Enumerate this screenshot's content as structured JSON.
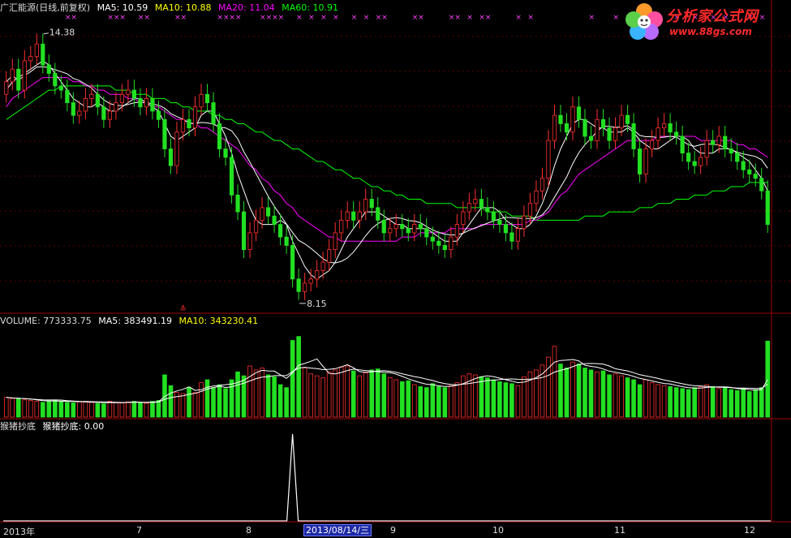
{
  "header": {
    "title": "广汇能源(日线,前复权)",
    "ma5": "MA5: 10.59",
    "ma10": "MA10: 10.88",
    "ma20": "MA20: 11.04",
    "ma60": "MA60: 10.91"
  },
  "volume_header": {
    "volume": "VOLUME: 773333.75",
    "ma5": "MA5: 383491.19",
    "ma10": "MA10: 343230.41"
  },
  "indicator_header": {
    "name": "猴猪抄底",
    "value": "猴猪抄底: 0.00"
  },
  "logo": {
    "title": "分析家公式网",
    "url": "www.88gs.com"
  },
  "x_axis": {
    "ticks": [
      "2013年",
      "7",
      "8",
      "9",
      "10",
      "11",
      "12"
    ],
    "cursor_date": "2013/08/14/三"
  },
  "colors": {
    "up": "#ff3030",
    "down": "#22e022",
    "ma5": "#ffffff",
    "ma10": "#ffff00",
    "ma20": "#ff00ff",
    "ma60": "#00ff00",
    "separator": "#a00000"
  },
  "chart_data": [
    {
      "type": "candlestick",
      "title": "广汇能源(日线,前复权)",
      "series": [
        {
          "name": "MA5",
          "value": 10.59
        },
        {
          "name": "MA10",
          "value": 10.88
        },
        {
          "name": "MA20",
          "value": 11.04
        },
        {
          "name": "MA60",
          "value": 10.91
        }
      ],
      "annotations": [
        {
          "text": "14.38",
          "kind": "high"
        },
        {
          "text": "8.15",
          "kind": "low"
        }
      ],
      "ylim": [
        7.8,
        14.8
      ],
      "close": [
        13.2,
        13.5,
        13.0,
        13.7,
        13.8,
        14.1,
        13.6,
        13.4,
        13.1,
        13.0,
        12.7,
        12.4,
        12.5,
        12.8,
        12.9,
        12.6,
        12.3,
        12.5,
        12.7,
        12.9,
        13.0,
        12.8,
        12.6,
        12.8,
        12.5,
        12.3,
        11.6,
        11.2,
        12.0,
        12.3,
        12.1,
        12.6,
        12.9,
        12.7,
        12.2,
        11.6,
        11.4,
        10.5,
        10.1,
        9.2,
        9.6,
        9.9,
        10.2,
        10.0,
        9.8,
        9.5,
        9.3,
        8.5,
        8.2,
        8.4,
        8.5,
        8.7,
        8.9,
        9.2,
        9.6,
        9.9,
        10.1,
        9.9,
        10.1,
        10.4,
        10.2,
        9.9,
        9.6,
        9.7,
        9.8,
        9.7,
        9.6,
        9.8,
        9.7,
        9.5,
        9.4,
        9.3,
        9.2,
        9.5,
        9.8,
        10.1,
        10.3,
        10.4,
        10.2,
        10.1,
        9.9,
        9.8,
        9.6,
        9.4,
        9.7,
        10.0,
        10.3,
        10.6,
        10.9,
        11.8,
        12.4,
        12.2,
        12.0,
        12.6,
        12.3,
        11.9,
        11.8,
        12.3,
        12.1,
        11.8,
        12.1,
        12.4,
        12.2,
        11.6,
        11.0,
        11.6,
        11.8,
        12.1,
        12.2,
        12.0,
        11.9,
        11.5,
        11.3,
        11.2,
        11.4,
        11.8,
        11.7,
        11.9,
        11.6,
        11.5,
        11.3,
        11.1,
        11.0,
        10.9,
        10.6,
        9.8
      ],
      "open": [
        12.9,
        13.2,
        13.5,
        13.0,
        13.7,
        13.8,
        14.1,
        13.6,
        13.4,
        13.1,
        13.0,
        12.7,
        12.4,
        12.5,
        12.8,
        12.9,
        12.6,
        12.3,
        12.5,
        12.7,
        12.9,
        13.0,
        12.8,
        12.6,
        12.8,
        12.5,
        12.3,
        11.6,
        11.2,
        12.0,
        12.3,
        12.1,
        12.6,
        12.9,
        12.7,
        12.2,
        11.6,
        11.4,
        10.5,
        10.1,
        9.2,
        9.6,
        9.9,
        10.2,
        10.0,
        9.8,
        9.5,
        9.3,
        8.5,
        8.2,
        8.4,
        8.5,
        8.7,
        8.9,
        9.2,
        9.6,
        9.9,
        10.1,
        9.9,
        10.1,
        10.4,
        10.2,
        9.9,
        9.6,
        9.7,
        9.8,
        9.7,
        9.6,
        9.8,
        9.7,
        9.5,
        9.4,
        9.3,
        9.2,
        9.5,
        9.8,
        10.1,
        10.3,
        10.4,
        10.2,
        10.1,
        9.9,
        9.8,
        9.6,
        9.4,
        9.7,
        10.0,
        10.3,
        10.6,
        10.9,
        11.8,
        12.4,
        12.2,
        12.0,
        12.6,
        12.3,
        11.9,
        11.8,
        12.3,
        12.1,
        11.8,
        12.1,
        12.4,
        12.2,
        11.6,
        11.0,
        11.6,
        11.8,
        12.1,
        12.2,
        12.0,
        11.9,
        11.5,
        11.3,
        11.2,
        11.4,
        11.8,
        11.7,
        11.9,
        11.6,
        11.5,
        11.3,
        11.1,
        11.0,
        10.9,
        10.6
      ],
      "ma5": [
        13.0,
        13.2,
        13.3,
        13.4,
        13.5,
        13.6,
        13.7,
        13.6,
        13.4,
        13.2,
        13.0,
        12.8,
        12.7,
        12.6,
        12.6,
        12.7,
        12.6,
        12.5,
        12.5,
        12.6,
        12.7,
        12.8,
        12.8,
        12.7,
        12.6,
        12.5,
        12.2,
        11.9,
        11.8,
        11.9,
        12.0,
        12.1,
        12.4,
        12.5,
        12.5,
        12.2,
        11.9,
        11.5,
        11.0,
        10.6,
        10.2,
        9.9,
        9.8,
        9.8,
        9.8,
        9.9,
        9.8,
        9.4,
        9.1,
        8.8,
        8.6,
        8.5,
        8.6,
        8.7,
        8.9,
        9.2,
        9.5,
        9.7,
        9.9,
        10.1,
        10.1,
        10.1,
        10.0,
        9.9,
        9.8,
        9.8,
        9.7,
        9.7,
        9.7,
        9.7,
        9.6,
        9.5,
        9.4,
        9.4,
        9.4,
        9.6,
        9.8,
        10.0,
        10.2,
        10.2,
        10.2,
        10.1,
        9.9,
        9.8,
        9.7,
        9.7,
        9.8,
        10.0,
        10.3,
        10.7,
        11.2,
        11.6,
        11.9,
        12.2,
        12.3,
        12.3,
        12.2,
        12.1,
        12.1,
        12.0,
        12.0,
        12.0,
        12.1,
        12.0,
        11.8,
        11.7,
        11.6,
        11.6,
        11.7,
        11.8,
        11.9,
        11.9,
        11.8,
        11.6,
        11.5,
        11.5,
        11.5,
        11.6,
        11.6,
        11.6,
        11.5,
        11.4,
        11.3,
        11.1,
        10.9,
        10.6
      ],
      "ma20": [
        12.6,
        12.8,
        12.9,
        13.0,
        13.1,
        13.2,
        13.3,
        13.3,
        13.3,
        13.3,
        13.3,
        13.2,
        13.2,
        13.1,
        13.1,
        13.0,
        13.0,
        12.9,
        12.9,
        12.9,
        12.8,
        12.8,
        12.7,
        12.7,
        12.6,
        12.6,
        12.5,
        12.4,
        12.3,
        12.3,
        12.2,
        12.2,
        12.1,
        12.1,
        12.0,
        11.9,
        11.8,
        11.7,
        11.6,
        11.4,
        11.2,
        11.1,
        10.9,
        10.8,
        10.6,
        10.5,
        10.3,
        10.2,
        10.0,
        9.9,
        9.8,
        9.7,
        9.6,
        9.5,
        9.5,
        9.4,
        9.4,
        9.4,
        9.4,
        9.4,
        9.4,
        9.4,
        9.4,
        9.4,
        9.4,
        9.5,
        9.5,
        9.5,
        9.6,
        9.6,
        9.6,
        9.6,
        9.6,
        9.7,
        9.7,
        9.7,
        9.7,
        9.7,
        9.8,
        9.8,
        9.8,
        9.8,
        9.8,
        9.8,
        9.8,
        9.8,
        9.9,
        9.9,
        10.0,
        10.1,
        10.3,
        10.5,
        10.6,
        10.8,
        11.0,
        11.1,
        11.2,
        11.3,
        11.4,
        11.5,
        11.6,
        11.7,
        11.8,
        11.8,
        11.8,
        11.8,
        11.8,
        11.9,
        11.9,
        11.9,
        11.9,
        11.9,
        11.9,
        11.9,
        11.8,
        11.8,
        11.8,
        11.8,
        11.8,
        11.8,
        11.7,
        11.7,
        11.6,
        11.6,
        11.5,
        11.4
      ],
      "ma60": [
        12.3,
        12.4,
        12.5,
        12.6,
        12.7,
        12.8,
        12.9,
        13.0,
        13.0,
        13.1,
        13.1,
        13.1,
        13.1,
        13.1,
        13.1,
        13.1,
        13.1,
        13.1,
        13.0,
        13.0,
        13.0,
        12.9,
        12.9,
        12.9,
        12.8,
        12.8,
        12.8,
        12.7,
        12.7,
        12.6,
        12.6,
        12.5,
        12.5,
        12.5,
        12.4,
        12.4,
        12.3,
        12.3,
        12.2,
        12.2,
        12.1,
        12.0,
        12.0,
        11.9,
        11.8,
        11.8,
        11.7,
        11.6,
        11.6,
        11.5,
        11.4,
        11.3,
        11.3,
        11.2,
        11.1,
        11.1,
        11.0,
        10.9,
        10.9,
        10.8,
        10.7,
        10.7,
        10.6,
        10.6,
        10.5,
        10.5,
        10.4,
        10.4,
        10.4,
        10.3,
        10.3,
        10.3,
        10.3,
        10.3,
        10.2,
        10.2,
        10.2,
        10.2,
        10.2,
        10.1,
        10.1,
        10.1,
        10.1,
        10.0,
        10.0,
        10.0,
        10.0,
        9.9,
        9.9,
        9.9,
        9.9,
        9.9,
        9.9,
        9.9,
        9.9,
        10.0,
        10.0,
        10.0,
        10.0,
        10.1,
        10.1,
        10.1,
        10.1,
        10.1,
        10.2,
        10.2,
        10.2,
        10.3,
        10.3,
        10.3,
        10.4,
        10.4,
        10.4,
        10.5,
        10.5,
        10.5,
        10.6,
        10.6,
        10.6,
        10.7,
        10.7,
        10.7,
        10.8,
        10.8,
        10.8,
        10.8
      ]
    },
    {
      "type": "bar",
      "title": "VOLUME: 773333.75",
      "series": [
        {
          "name": "VOLUME",
          "value": 773333.75
        },
        {
          "name": "MA5",
          "value": 383491.19
        },
        {
          "name": "MA10",
          "value": 343230.41
        }
      ],
      "ylim": [
        0,
        900000
      ],
      "values": [
        200000,
        190000,
        185000,
        175000,
        170000,
        160000,
        150000,
        165000,
        175000,
        160000,
        150000,
        145000,
        155000,
        160000,
        150000,
        140000,
        135000,
        160000,
        150000,
        145000,
        155000,
        160000,
        150000,
        140000,
        160000,
        170000,
        430000,
        320000,
        250000,
        240000,
        300000,
        250000,
        350000,
        380000,
        300000,
        330000,
        290000,
        380000,
        460000,
        420000,
        520000,
        480000,
        500000,
        430000,
        410000,
        330000,
        300000,
        780000,
        820000,
        500000,
        440000,
        420000,
        400000,
        460000,
        480000,
        510000,
        520000,
        470000,
        420000,
        450000,
        480000,
        490000,
        440000,
        400000,
        380000,
        360000,
        370000,
        330000,
        310000,
        300000,
        340000,
        310000,
        300000,
        320000,
        350000,
        420000,
        440000,
        430000,
        410000,
        400000,
        380000,
        360000,
        350000,
        340000,
        320000,
        410000,
        460000,
        480000,
        530000,
        610000,
        720000,
        540000,
        500000,
        560000,
        540000,
        500000,
        480000,
        460000,
        470000,
        430000,
        440000,
        420000,
        400000,
        380000,
        330000,
        380000,
        350000,
        330000,
        320000,
        310000,
        300000,
        290000,
        280000,
        300000,
        310000,
        330000,
        310000,
        290000,
        300000,
        280000,
        270000,
        290000,
        260000,
        280000,
        300000,
        773333
      ]
    },
    {
      "type": "line",
      "title": "猴猪抄底",
      "series": [
        {
          "name": "猴猪抄底",
          "value": 0.0
        }
      ],
      "ylim": [
        0,
        1
      ],
      "spike_index": 47
    }
  ]
}
